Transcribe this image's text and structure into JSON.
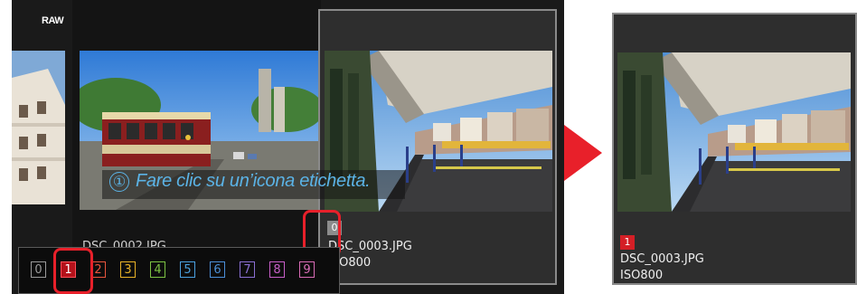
{
  "left": {
    "raw_badge": "RAW",
    "center_filename": "DSC_0002.JPG",
    "right_label_value": "0",
    "right_filename": "DSC_0003.JPG",
    "right_iso": "ISO800"
  },
  "instruction": {
    "number": "①",
    "text": "Fare clic su un’icona etichetta."
  },
  "toolbar": {
    "labels": [
      {
        "text": "0",
        "color": "#9a9a9a"
      },
      {
        "text": "1",
        "color": "#ff4d57"
      },
      {
        "text": "2",
        "color": "#e8553d"
      },
      {
        "text": "3",
        "color": "#e9b227"
      },
      {
        "text": "4",
        "color": "#7cc243"
      },
      {
        "text": "5",
        "color": "#4aa0e0"
      },
      {
        "text": "6",
        "color": "#4b8fd8"
      },
      {
        "text": "7",
        "color": "#8a6fd3"
      },
      {
        "text": "8",
        "color": "#c75fc8"
      },
      {
        "text": "9",
        "color": "#d86cb6"
      }
    ],
    "selected": "1"
  },
  "result": {
    "label_value": "1",
    "filename": "DSC_0003.JPG",
    "iso": "ISO800"
  },
  "colors": {
    "accent_red": "#e8202a",
    "instruction_blue": "#5bb3e6"
  }
}
